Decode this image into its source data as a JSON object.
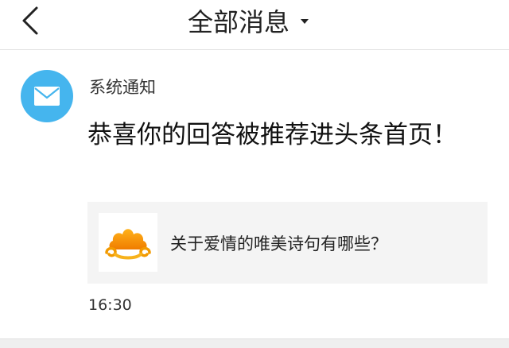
{
  "header": {
    "title": "全部消息",
    "back_icon": "chevron-left-icon",
    "dropdown_icon": "caret-down-icon"
  },
  "notification": {
    "avatar_icon": "mail-icon",
    "avatar_color": "#45b5ee",
    "sender": "系统通知",
    "message": "恭喜你的回答被推荐进头条首页！",
    "card": {
      "thumbnail_icon": "golden-cloud-logo-icon",
      "question": "关于爱情的唯美诗句有哪些？"
    },
    "time": "16:30"
  }
}
